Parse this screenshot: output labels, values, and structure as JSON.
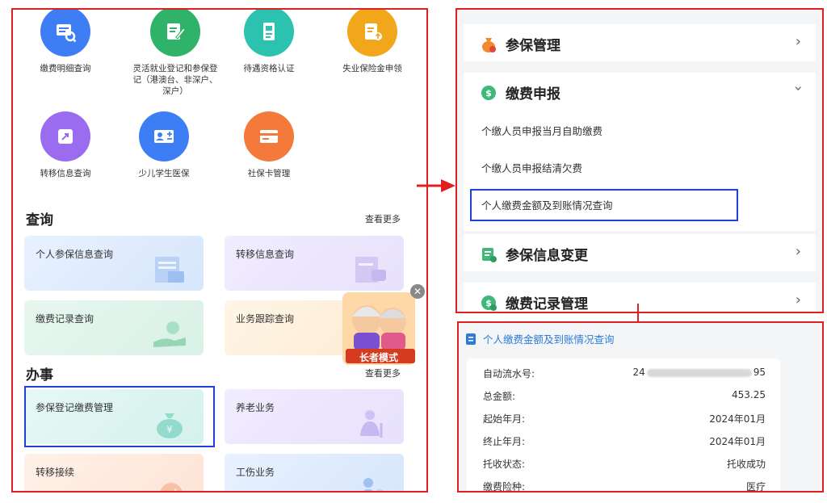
{
  "left": {
    "services": [
      {
        "label": "缴费明细查询",
        "icon": "invoice-search-icon",
        "color": "#3d7ef5"
      },
      {
        "label": "灵活就业登记和参保登记（港澳台、非深户、深户）",
        "icon": "edit-form-icon",
        "color": "#2fb36b"
      },
      {
        "label": "待遇资格认证",
        "icon": "id-verify-icon",
        "color": "#2cc2b0"
      },
      {
        "label": "失业保险金申领",
        "icon": "upload-doc-icon",
        "color": "#f2a71b"
      },
      {
        "label": "转移信息查询",
        "icon": "transfer-icon",
        "color": "#9b6cf0"
      },
      {
        "label": "少儿学生医保",
        "icon": "add-person-card-icon",
        "color": "#3d7ef5"
      },
      {
        "label": "社保卡管理",
        "icon": "card-icon",
        "color": "#f47a3b"
      }
    ],
    "query": {
      "title": "查询",
      "more": "查看更多",
      "cards": [
        "个人参保信息查询",
        "转移信息查询",
        "缴费记录查询",
        "业务跟踪查询"
      ]
    },
    "affairs": {
      "title": "办事",
      "more": "查看更多",
      "cards": [
        "参保登记缴费管理",
        "养老业务",
        "转移接续",
        "工伤业务"
      ]
    },
    "elder_mode": "长者模式"
  },
  "right_top": {
    "sections": [
      {
        "title": "参保管理",
        "icon": "moneybag-icon",
        "state": "collapsed"
      },
      {
        "title": "缴费申报",
        "icon": "payment-declare-icon",
        "state": "expanded"
      },
      {
        "title": "参保信息变更",
        "icon": "info-change-icon",
        "state": "collapsed"
      },
      {
        "title": "缴费记录管理",
        "icon": "payment-record-icon",
        "state": "collapsed"
      }
    ],
    "sub_items": [
      "个缴人员申报当月自助缴费",
      "个缴人员申报结清欠费",
      "个人缴费金额及到账情况查询"
    ]
  },
  "right_bottom": {
    "header": "个人缴费金额及到账情况查询",
    "rows": [
      {
        "key": "自动流水号:",
        "value_prefix": "24",
        "value_suffix": "95"
      },
      {
        "key": "总金额:",
        "value": "453.25"
      },
      {
        "key": "起始年月:",
        "value": "2024年01月"
      },
      {
        "key": "终止年月:",
        "value": "2024年01月"
      },
      {
        "key": "托收状态:",
        "value": "托收成功"
      },
      {
        "key": "缴费险种:",
        "value": "医疗"
      }
    ]
  }
}
